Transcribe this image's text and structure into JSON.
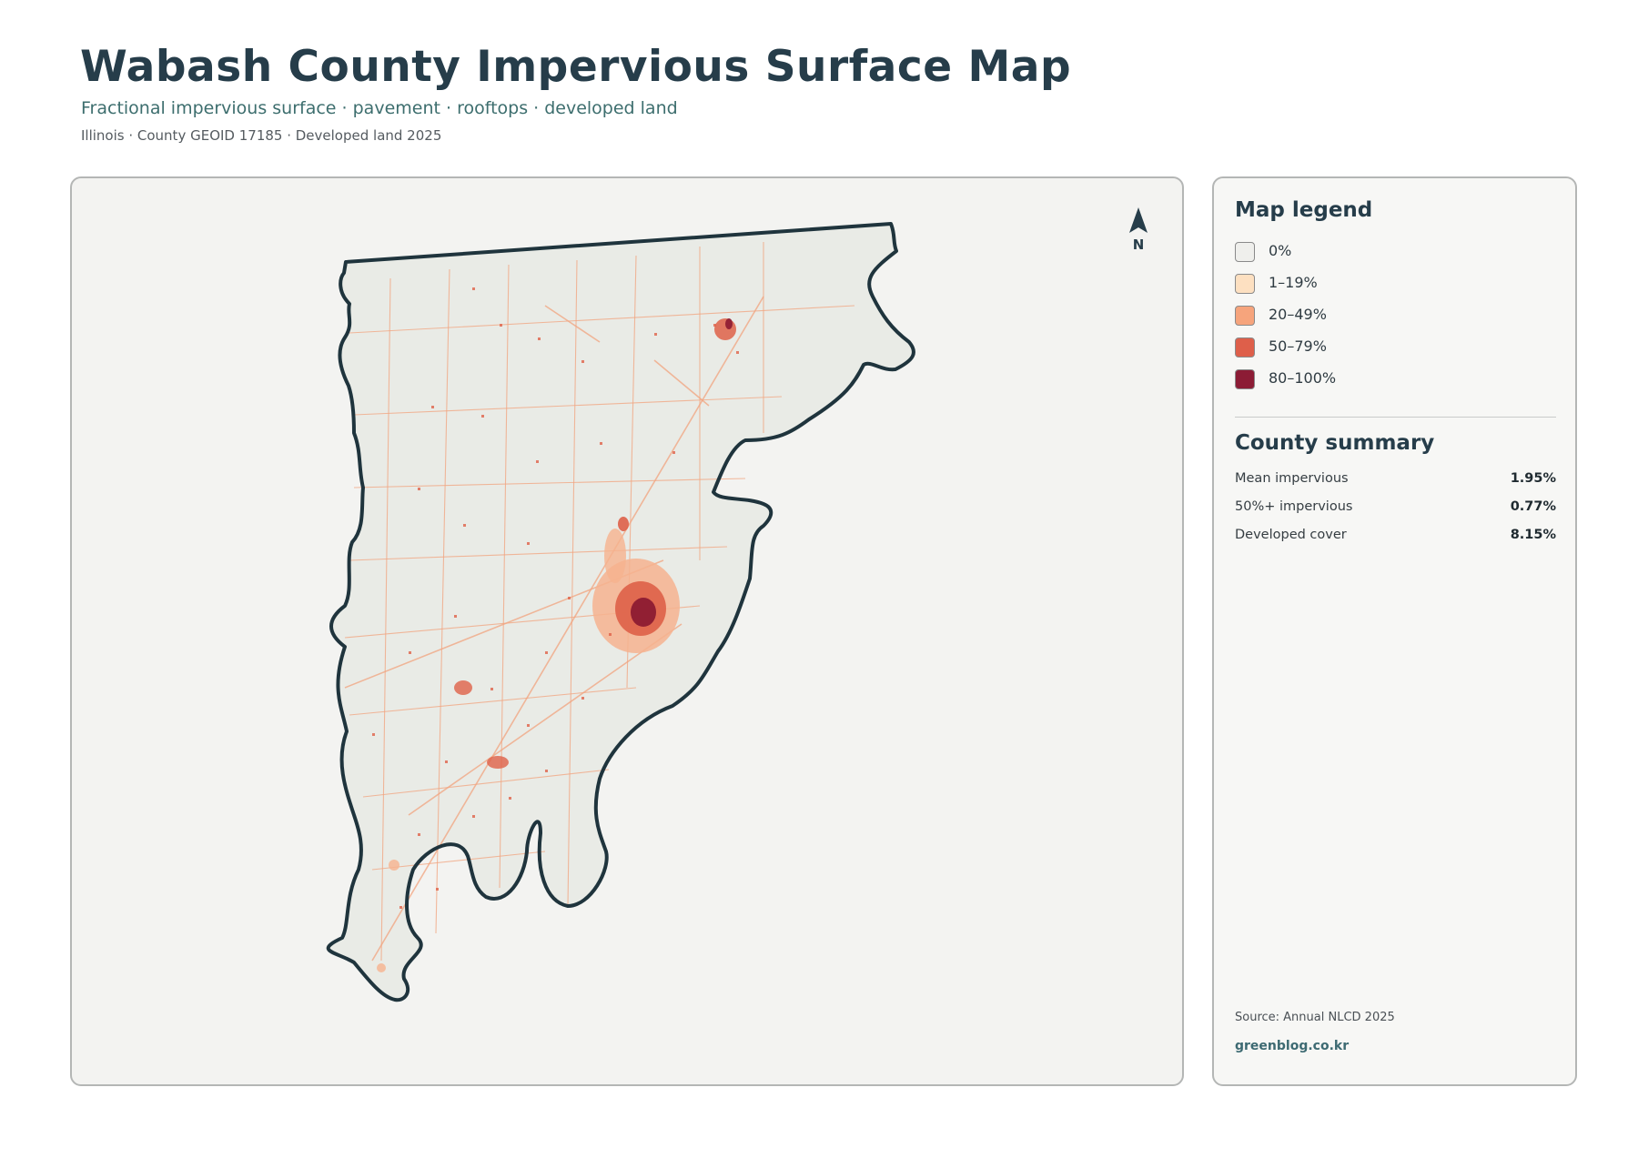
{
  "header": {
    "title": "Wabash County Impervious Surface Map",
    "subtitle": "Fractional impervious surface · pavement · rooftops · developed land",
    "meta": "Illinois · County GEOID 17185 · Developed land 2025"
  },
  "map": {
    "north_label": "N",
    "colors": {
      "land": "#e9ebe6",
      "outline": "#1f343d",
      "road": "#f2a47f",
      "urban_low": "#f6b38f",
      "urban_mid": "#de6148",
      "urban_high": "#8c1b32"
    }
  },
  "legend": {
    "title": "Map legend",
    "items": [
      {
        "label": "0%",
        "color": "#efefec"
      },
      {
        "label": "1–19%",
        "color": "#fde0c1"
      },
      {
        "label": "20–49%",
        "color": "#f6a47c"
      },
      {
        "label": "50–79%",
        "color": "#de5f4a"
      },
      {
        "label": "80–100%",
        "color": "#8c1c35"
      }
    ]
  },
  "summary": {
    "title": "County summary",
    "stats": [
      {
        "label": "Mean impervious",
        "value": "1.95%"
      },
      {
        "label": "50%+ impervious",
        "value": "0.77%"
      },
      {
        "label": "Developed cover",
        "value": "8.15%"
      }
    ]
  },
  "footer": {
    "source": "Source: Annual NLCD 2025",
    "site": "greenblog.co.kr"
  }
}
